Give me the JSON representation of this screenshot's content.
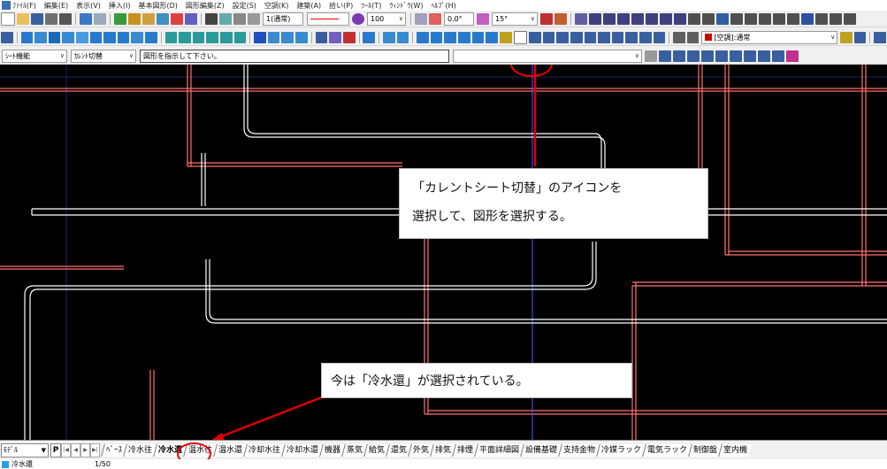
{
  "menu": [
    "ﾌｧｲﾙ(F)",
    "編集(E)",
    "表示(V)",
    "挿入(I)",
    "基本図形(D)",
    "図形編集(Z)",
    "設定(S)",
    "空調(K)",
    "建築(A)",
    "拾い(P)",
    "ﾂｰﾙ(T)",
    "ｳｨﾝﾄﾞｳ(W)",
    "ﾍﾙﾌﾟ(H)"
  ],
  "toolbar1": {
    "layer_combo": "1(通常)",
    "pen_value": "100",
    "offset_value": "0.0°",
    "angle_value": "15°"
  },
  "toolbar2": {
    "hvac_combo": "[空調]:通常"
  },
  "toolbar3": {
    "sheet_func": "ｼｰﾄ機能",
    "current_switch": "ｶﾚﾝﾄ切替",
    "prompt": "図形を指示して下さい。"
  },
  "callouts": {
    "first_line1": "「カレントシート切替」のアイコンを",
    "first_line2": "選択して、図形を選択する。",
    "second": "今は「冷水還」が選択されている。"
  },
  "tabbar": {
    "model": "ﾓﾃﾞﾙ",
    "p_label": "P"
  },
  "tabs": [
    "ﾍﾞｰｽ",
    "冷水往",
    "冷水還",
    "温水往",
    "温水還",
    "冷却水往",
    "冷却水還",
    "機器",
    "蒸気",
    "給気",
    "還気",
    "外気",
    "排気",
    "排煙",
    "平面詳細図",
    "設備基礎",
    "支持金物",
    "冷媒ラック",
    "電気ラック",
    "制御盤",
    "室内機"
  ],
  "active_tab": "冷水還",
  "status": {
    "layer": "冷水還",
    "scale": "1/50"
  },
  "colors": {
    "canvas": "#000000",
    "pipe_red": "#ff7070",
    "pipe_white": "#ffffff",
    "accent": "#e00000"
  }
}
